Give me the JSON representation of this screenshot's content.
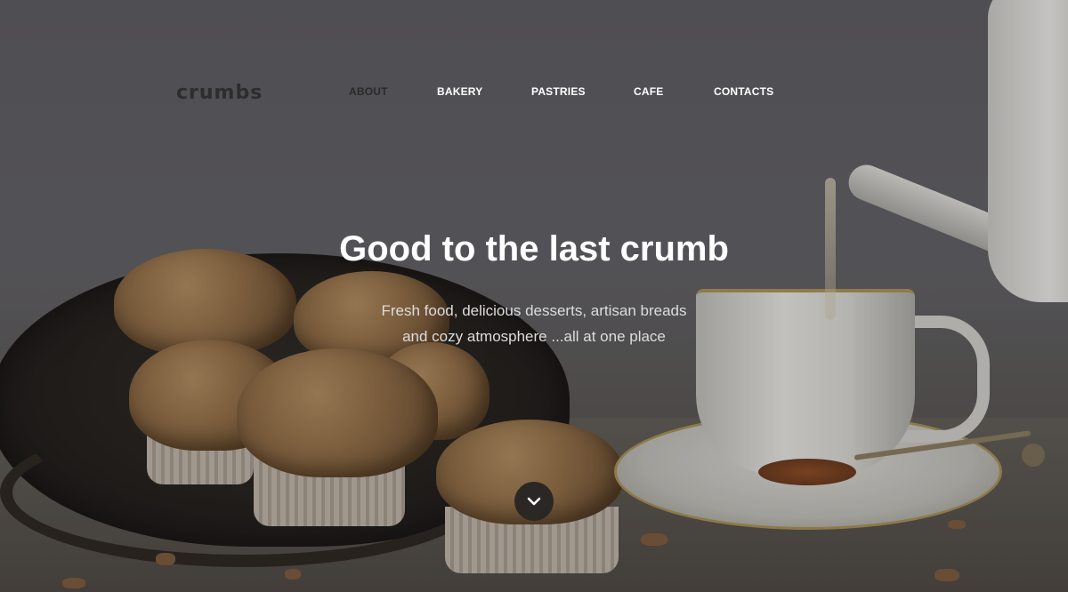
{
  "brand": {
    "logo_text": "crumbs"
  },
  "nav": {
    "items": [
      {
        "label": "ABOUT",
        "active": true
      },
      {
        "label": "BAKERY",
        "active": false
      },
      {
        "label": "PASTRIES",
        "active": false
      },
      {
        "label": "CAFE",
        "active": false
      },
      {
        "label": "CONTACTS",
        "active": false
      }
    ]
  },
  "hero": {
    "title": "Good to the last crumb",
    "subtitle_line1": "Fresh food, delicious desserts, artisan breads",
    "subtitle_line2": "and cozy atmosphere ...all at one place",
    "scroll_icon": "chevron-down-icon"
  },
  "colors": {
    "background": "#5d5c60",
    "nav_text": "#ffffff",
    "nav_active": "#2b2929",
    "scroll_button": "#2b2725"
  }
}
